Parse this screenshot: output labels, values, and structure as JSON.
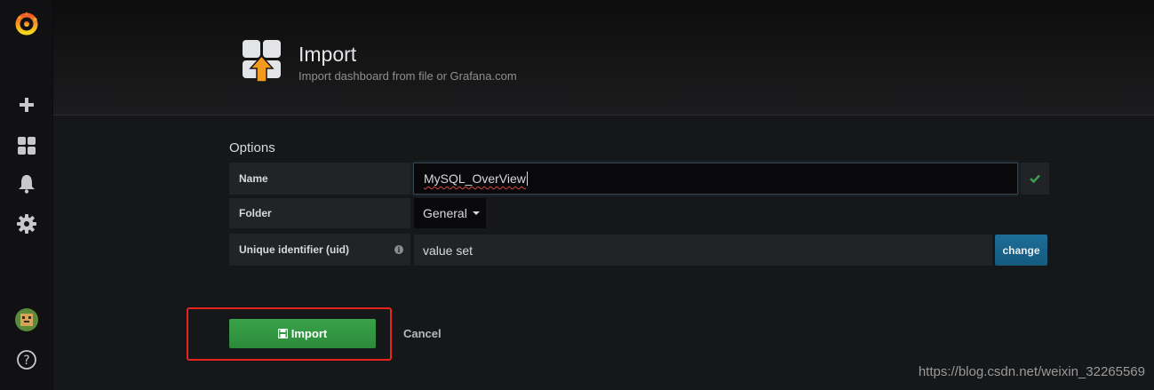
{
  "sidebar": {
    "icons": [
      "grafana-logo-icon",
      "plus-icon",
      "dashboards-icon",
      "bell-icon",
      "gear-icon",
      "user-avatar",
      "help-icon"
    ]
  },
  "header": {
    "title": "Import",
    "subtitle": "Import dashboard from file or Grafana.com",
    "icon": "import-dashboard-icon"
  },
  "options": {
    "title": "Options",
    "name_label": "Name",
    "name_value": "MySQL_OverView",
    "folder_label": "Folder",
    "folder_value": "General",
    "uid_label": "Unique identifier (uid)",
    "uid_value": "value set",
    "change_label": "change"
  },
  "actions": {
    "import_label": "Import",
    "cancel_label": "Cancel"
  },
  "watermark": "https://blog.csdn.net/weixin_32265569",
  "colors": {
    "background": "#161719",
    "import_button": "#3aa24a",
    "change_button": "#1d6e99",
    "highlight": "#e8241c",
    "valid_check": "#3aa24a"
  }
}
